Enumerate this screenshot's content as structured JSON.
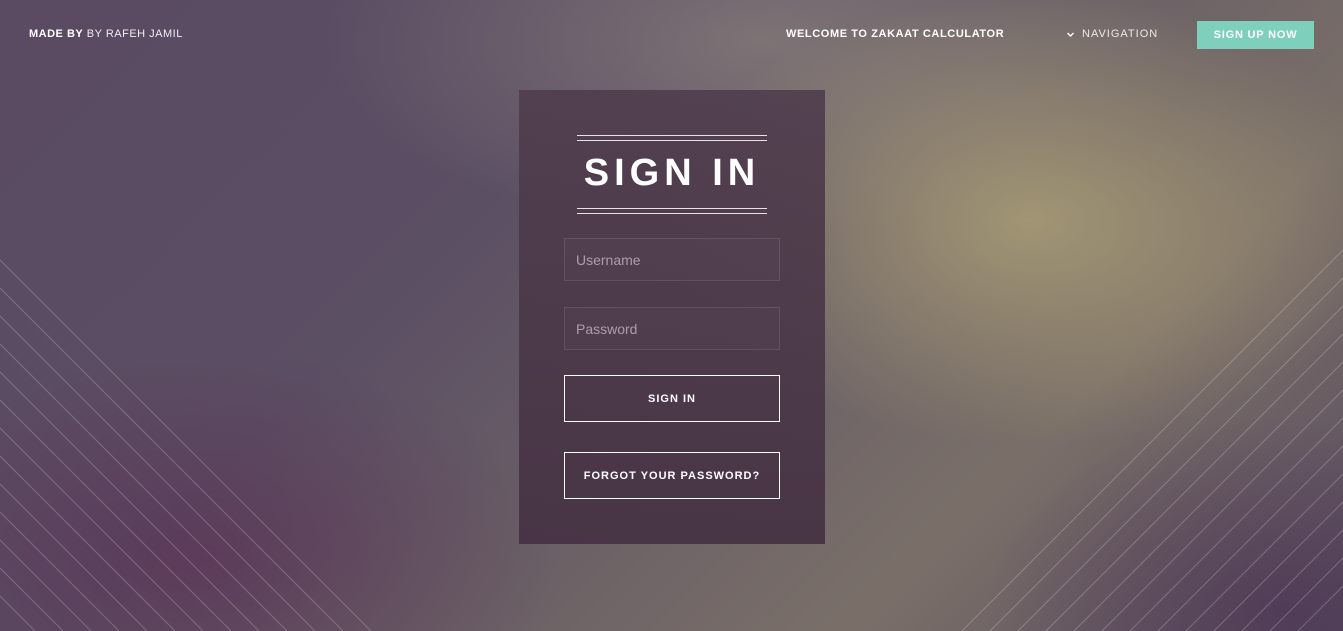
{
  "header": {
    "brand_bold": "MADE BY",
    "brand_light": "BY RAFEH JAMIL",
    "welcome": "WELCOME TO ZAKAAT CALCULATOR",
    "nav_label": "NAVIGATION",
    "signup_label": "SIGN UP NOW"
  },
  "login": {
    "title": "SIGN IN",
    "username_placeholder": "Username",
    "password_placeholder": "Password",
    "signin_label": "SIGN IN",
    "forgot_label": "FORGOT YOUR PASSWORD?"
  },
  "colors": {
    "signup_bg": "#7fcfbd",
    "card_bg": "#4d3a4c",
    "text": "#ffffff"
  }
}
